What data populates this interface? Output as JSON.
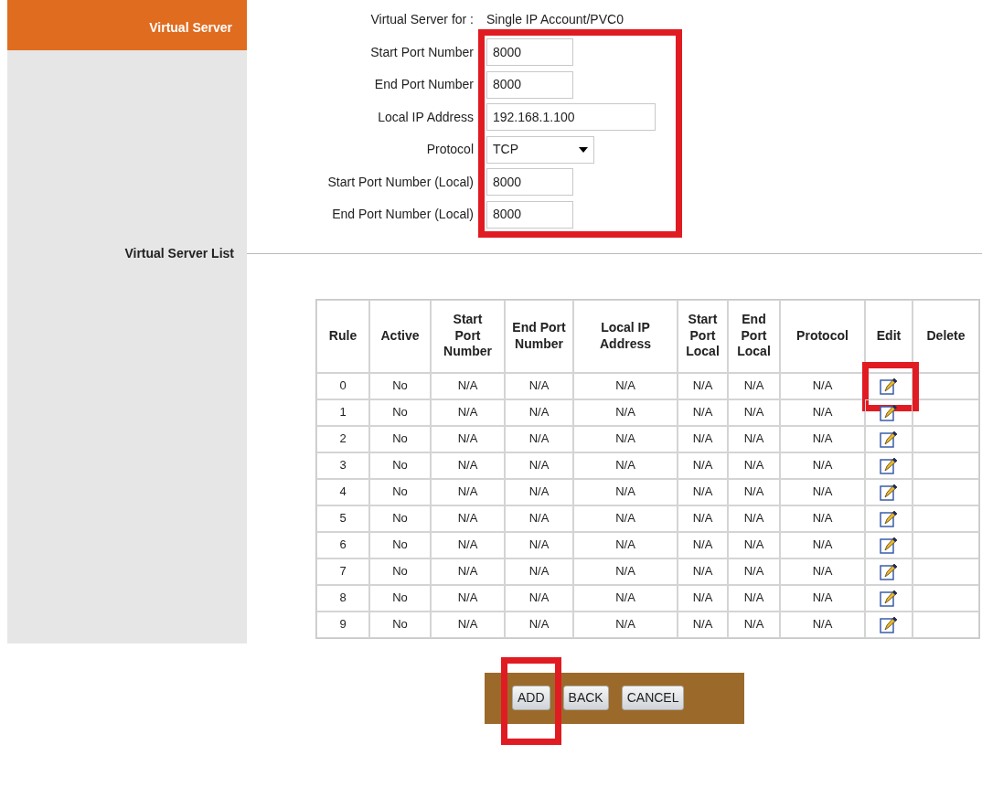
{
  "sidebar": {
    "title": "Virtual Server",
    "section_label": "Virtual Server List"
  },
  "form": {
    "highlighted": true,
    "caption": {
      "label": "Virtual Server for :",
      "value": "Single IP Account/PVC0"
    },
    "fields": [
      {
        "kind": "text",
        "label": "Start Port Number",
        "value": "8000"
      },
      {
        "kind": "text",
        "label": "End Port Number",
        "value": "8000"
      },
      {
        "kind": "ip",
        "label": "Local IP Address",
        "value": "192.168.1.100"
      },
      {
        "kind": "select",
        "label": "Protocol",
        "value": "TCP"
      },
      {
        "kind": "text",
        "label": "Start Port Number (Local)",
        "value": "8000"
      },
      {
        "kind": "text",
        "label": "End Port Number (Local)",
        "value": "8000"
      }
    ]
  },
  "table": {
    "columns": [
      "Rule",
      "Active",
      "Start\nPort\nNumber",
      "End Port\nNumber",
      "Local IP\nAddress",
      "Start\nPort\nLocal",
      "End\nPort\nLocal",
      "Protocol",
      "Edit",
      "Delete"
    ],
    "rows": [
      {
        "cells": [
          "0",
          "No",
          "N/A",
          "N/A",
          "N/A",
          "N/A",
          "N/A",
          "N/A"
        ],
        "edit_highlighted": true
      },
      {
        "cells": [
          "1",
          "No",
          "N/A",
          "N/A",
          "N/A",
          "N/A",
          "N/A",
          "N/A"
        ],
        "edit_highlighted": false
      },
      {
        "cells": [
          "2",
          "No",
          "N/A",
          "N/A",
          "N/A",
          "N/A",
          "N/A",
          "N/A"
        ],
        "edit_highlighted": false
      },
      {
        "cells": [
          "3",
          "No",
          "N/A",
          "N/A",
          "N/A",
          "N/A",
          "N/A",
          "N/A"
        ],
        "edit_highlighted": false
      },
      {
        "cells": [
          "4",
          "No",
          "N/A",
          "N/A",
          "N/A",
          "N/A",
          "N/A",
          "N/A"
        ],
        "edit_highlighted": false
      },
      {
        "cells": [
          "5",
          "No",
          "N/A",
          "N/A",
          "N/A",
          "N/A",
          "N/A",
          "N/A"
        ],
        "edit_highlighted": false
      },
      {
        "cells": [
          "6",
          "No",
          "N/A",
          "N/A",
          "N/A",
          "N/A",
          "N/A",
          "N/A"
        ],
        "edit_highlighted": false
      },
      {
        "cells": [
          "7",
          "No",
          "N/A",
          "N/A",
          "N/A",
          "N/A",
          "N/A",
          "N/A"
        ],
        "edit_highlighted": false
      },
      {
        "cells": [
          "8",
          "No",
          "N/A",
          "N/A",
          "N/A",
          "N/A",
          "N/A",
          "N/A"
        ],
        "edit_highlighted": false
      },
      {
        "cells": [
          "9",
          "No",
          "N/A",
          "N/A",
          "N/A",
          "N/A",
          "N/A",
          "N/A"
        ],
        "edit_highlighted": false
      }
    ]
  },
  "buttons": [
    {
      "label": "ADD",
      "highlighted": true
    },
    {
      "label": "BACK",
      "highlighted": false
    },
    {
      "label": "CANCEL",
      "highlighted": false
    }
  ]
}
